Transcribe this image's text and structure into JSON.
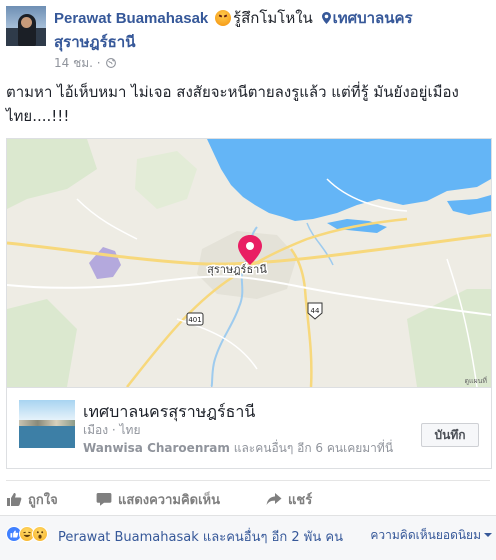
{
  "post": {
    "author": "Perawat Buamahasak",
    "feeling": "รู้สึกโมโหใน",
    "location": "เทศบาลนคร",
    "location_line2": "สุราษฎร์ธานี",
    "timestamp": "14 ชม.",
    "dot": "·",
    "text": "ตามหา ไอ้เห็บหมา ไม่เจอ สงสัยจะหนีตายลงรูแล้ว แต่ที่รู้ มันยังอยู่เมืองไทย....!!!",
    "privacy_icon": "globe-icon",
    "feeling_icon": "angry-emoji-icon"
  },
  "map": {
    "city_label": "สุราษฎร์ธานี",
    "road_401": "401",
    "road_44": "44",
    "attribution": "ดูแผนที่",
    "colors": {
      "water": "#64b5f6",
      "land": "#eeece4",
      "pin": "#e91e63",
      "road": "#f7d87c"
    }
  },
  "place": {
    "title": "เทศบาลนครสุราษฎร์ธานี",
    "subtitle": "เมือง · ไทย",
    "people_name": "Wanwisa Charoenram",
    "people_rest": " และคนอื่นๆ อีก 6 คนเคยมาที่นี่",
    "save_label": "บันทึก"
  },
  "actions": {
    "like": "ถูกใจ",
    "comment": "แสดงความคิดเห็น",
    "share": "แชร์"
  },
  "reactions": {
    "summary": "Perawat Buamahasak และคนอื่นๆ อีก 2 พัน คน",
    "sort_label": "ความคิดเห็นยอดนิยม"
  }
}
